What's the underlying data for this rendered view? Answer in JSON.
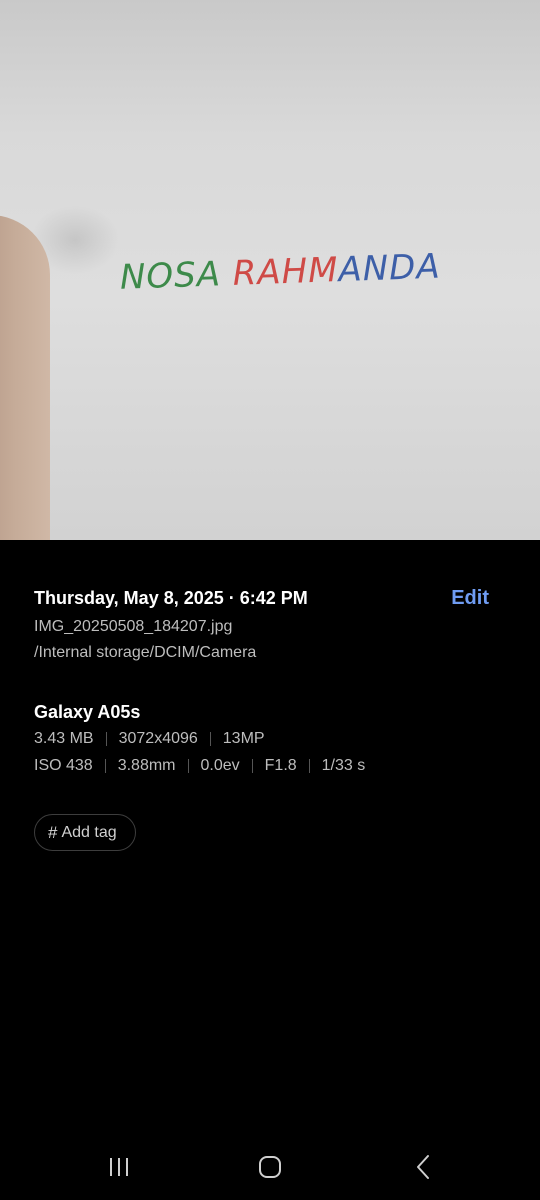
{
  "photo": {
    "text_words": [
      "NOSA",
      "RAHM",
      "ANDA"
    ]
  },
  "details": {
    "datetime": "Thursday, May 8, 2025 · 6:42 PM",
    "edit_label": "Edit",
    "filename": "IMG_20250508_184207.jpg",
    "path": "/Internal storage/DCIM/Camera",
    "device": "Galaxy A05s",
    "file_specs": [
      "3.43 MB",
      "3072x4096",
      "13MP"
    ],
    "camera_specs": [
      "ISO 438",
      "3.88mm",
      "0.0ev",
      "F1.8",
      "1/33 s"
    ]
  },
  "tag": {
    "icon": "hash-icon",
    "label": "Add tag"
  },
  "navbar": {
    "recents_icon": "recents-icon",
    "home_icon": "home-icon",
    "back_icon": "back-icon"
  },
  "colors": {
    "accent": "#6f9cf2",
    "background": "#000000",
    "secondary_text": "#bdbdbd"
  }
}
